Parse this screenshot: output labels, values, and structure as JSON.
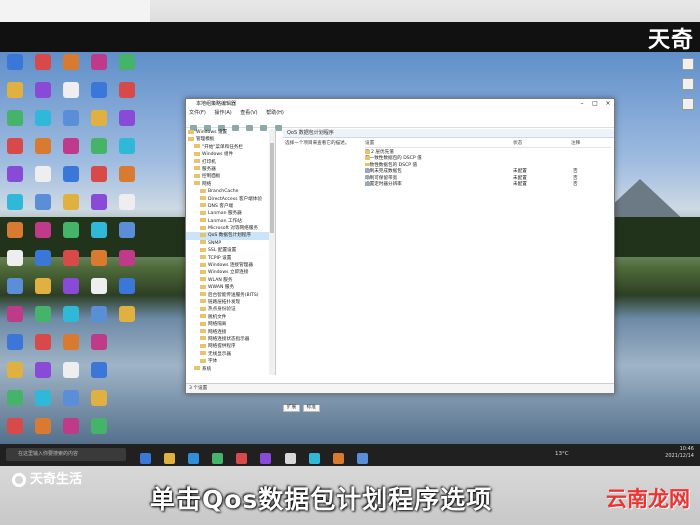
{
  "brand_top": "天奇",
  "window": {
    "title": "本地组策略编辑器",
    "menu": [
      "文件(F)",
      "操作(A)",
      "查看(V)",
      "帮助(H)"
    ],
    "tree": [
      {
        "label": "Windows 设置",
        "depth": 1
      },
      {
        "label": "管理模板",
        "depth": 1
      },
      {
        "label": "\"开始\"菜单和任务栏",
        "depth": 2
      },
      {
        "label": "Windows 组件",
        "depth": 2
      },
      {
        "label": "打印机",
        "depth": 2
      },
      {
        "label": "服务器",
        "depth": 2
      },
      {
        "label": "控制面板",
        "depth": 2
      },
      {
        "label": "网络",
        "depth": 2
      },
      {
        "label": "BranchCache",
        "depth": 3
      },
      {
        "label": "DirectAccess 客户端体验",
        "depth": 3
      },
      {
        "label": "DNS 客户端",
        "depth": 3
      },
      {
        "label": "Lanman 服务器",
        "depth": 3
      },
      {
        "label": "Lanman 工作站",
        "depth": 3
      },
      {
        "label": "Microsoft 对等网络服务",
        "depth": 3
      },
      {
        "label": "QoS 数据包计划程序",
        "depth": 3,
        "selected": true
      },
      {
        "label": "SNMP",
        "depth": 3
      },
      {
        "label": "SSL 配置设置",
        "depth": 3
      },
      {
        "label": "TCPIP 设置",
        "depth": 3
      },
      {
        "label": "Windows 连接管理器",
        "depth": 3
      },
      {
        "label": "Windows 立即连接",
        "depth": 3
      },
      {
        "label": "WLAN 服务",
        "depth": 3
      },
      {
        "label": "WWAN 服务",
        "depth": 3
      },
      {
        "label": "后台智能传送服务(BITS)",
        "depth": 3
      },
      {
        "label": "链路层拓扑发现",
        "depth": 3
      },
      {
        "label": "热点身份验证",
        "depth": 3
      },
      {
        "label": "脱机文件",
        "depth": 3
      },
      {
        "label": "网络隔离",
        "depth": 3
      },
      {
        "label": "网络连接",
        "depth": 3
      },
      {
        "label": "网络连接状态指示器",
        "depth": 3
      },
      {
        "label": "网络提供程序",
        "depth": 3
      },
      {
        "label": "无线显示器",
        "depth": 3
      },
      {
        "label": "字体",
        "depth": 3
      },
      {
        "label": "系统",
        "depth": 2
      }
    ],
    "detail_header": "QoS 数据包计划程序",
    "detail_desc": "选择一个项目来查看它的描述。",
    "columns": {
      "setting": "设置",
      "state": "状态",
      "comment": "注释"
    },
    "rows": [
      {
        "name": "第 2 层优先值",
        "state": "",
        "comment": "",
        "folder": true
      },
      {
        "name": "非一致性数据包的 DSCP 值",
        "state": "",
        "comment": "",
        "folder": true
      },
      {
        "name": "一致性数据包的 DSCP 值",
        "state": "",
        "comment": "",
        "folder": true
      },
      {
        "name": "限制未完成数据包",
        "state": "未配置",
        "comment": "否",
        "folder": false
      },
      {
        "name": "限制可保留带宽",
        "state": "未配置",
        "comment": "否",
        "folder": false
      },
      {
        "name": "设置定时器分辨率",
        "state": "未配置",
        "comment": "否",
        "folder": false
      }
    ],
    "tabs": [
      "扩展",
      "标准"
    ],
    "status": "3 个设置"
  },
  "taskbar": {
    "search_placeholder": "在这里输入你要搜索的内容",
    "weather": "13°C",
    "time": "10:46",
    "date": "2021/12/14"
  },
  "logo_text": "天奇生活",
  "caption": "单击Qos数据包计划程序选项",
  "watermark": "云南龙网",
  "colors": {
    "selection": "#cce4f7",
    "folder": "#e8c36a",
    "caption": "#ffffff",
    "watermark": "#ee3333"
  }
}
